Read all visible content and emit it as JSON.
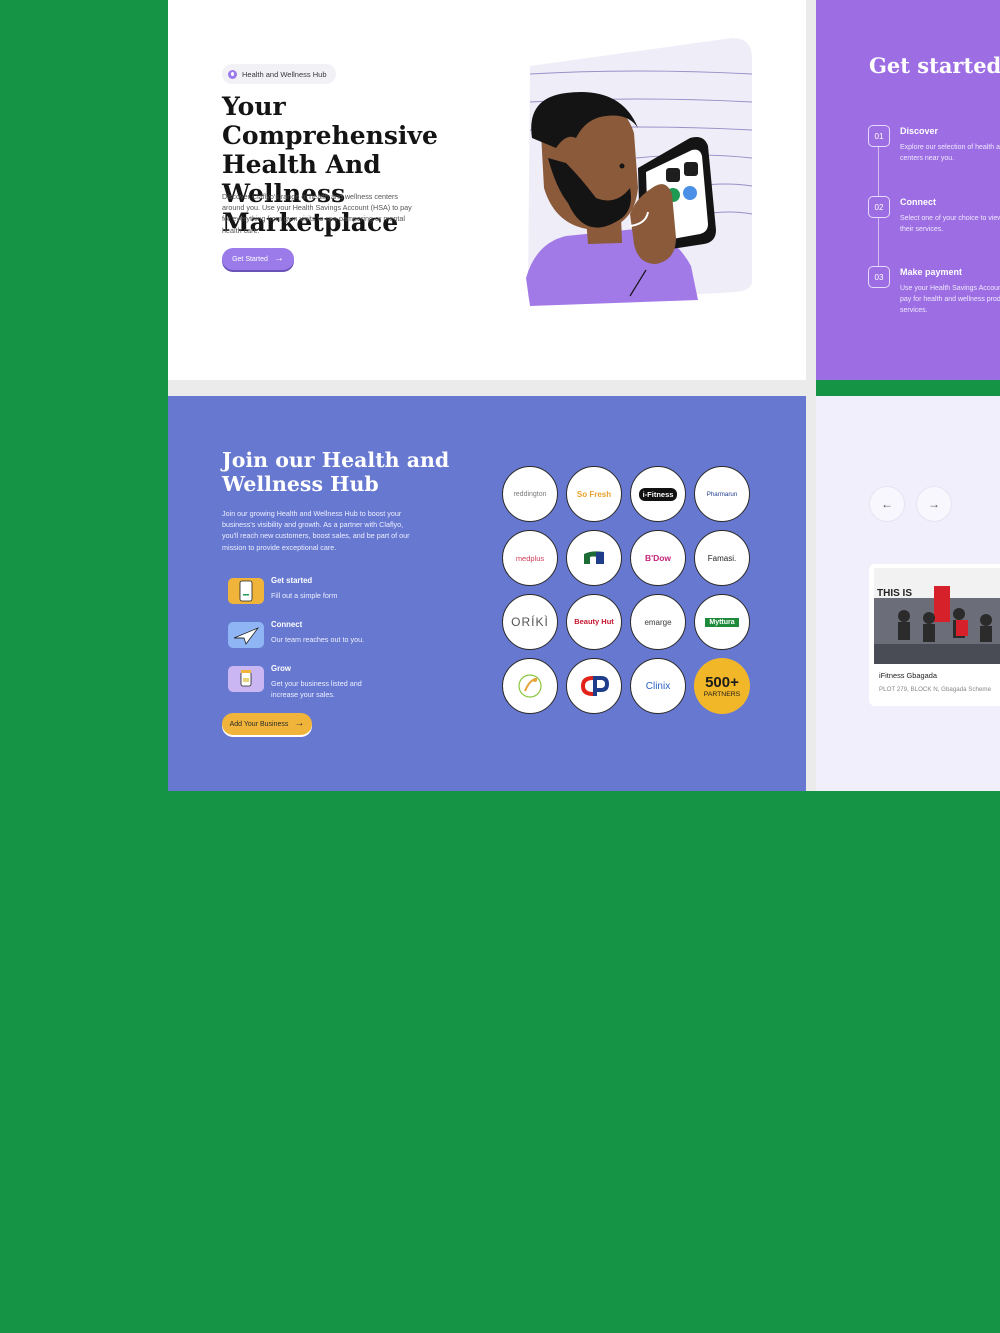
{
  "hero": {
    "badge": "Health and Wellness Hub",
    "title": "Your Comprehensive Health And Wellness Marketplace",
    "description": "Discover Claflyo's range of health and wellness centers around you. Use your Health Savings Account (HSA) to pay for everything from gym visits to spa pampering or mental health care.",
    "cta_label": "Get Started"
  },
  "steps": {
    "title": "Get started in easy steps...",
    "items": [
      {
        "num": "01",
        "title": "Discover",
        "desc_line1": "Explore our selection of health and wellness",
        "desc_line2": "centers near you."
      },
      {
        "num": "02",
        "title": "Connect",
        "desc_line1": "Select one of your choice to view",
        "desc_line2": "their services."
      },
      {
        "num": "03",
        "title": "Make payment",
        "desc_line1": "Use your Health Savings Account (HSA) to",
        "desc_line2": "pay for health and wellness products and",
        "desc_line3": "services."
      }
    ]
  },
  "join": {
    "title": "Join our Health and Wellness Hub",
    "description": "Join our growing Health and Wellness Hub to boost your business's visibility and growth. As a partner with Claflyo, you'll reach new customers, boost sales, and be part of our mission to provide exceptional care.",
    "features": [
      {
        "title": "Get started",
        "desc": "Fill out a simple form"
      },
      {
        "title": "Connect",
        "desc": "Our team reaches out to you."
      },
      {
        "title": "Grow",
        "desc": "Get your business listed and increase your sales."
      }
    ],
    "cta_label": "Add Your Business",
    "partners": [
      "reddington",
      "So Fresh",
      "i-Fitness",
      "Pharmarun",
      "medplus",
      "",
      "B'Dow",
      "Famasi.",
      "ORÍKÌ",
      "Beauty Hut",
      "emarge",
      "Myttura",
      "",
      "",
      "Clinix"
    ],
    "partners_count": "500+",
    "partners_label": "PARTNERS"
  },
  "listing": {
    "prev_icon": "←",
    "next_icon": "→",
    "card_name": "iFitness Gbagada",
    "card_address": "PLOT 279, BLOCK N, Gbagada Scheme",
    "photo_text": "THIS IS"
  },
  "colors": {
    "background": "#169445",
    "purple": "#9d6ee3",
    "blue": "#6778d0",
    "yellow": "#f2b728"
  }
}
